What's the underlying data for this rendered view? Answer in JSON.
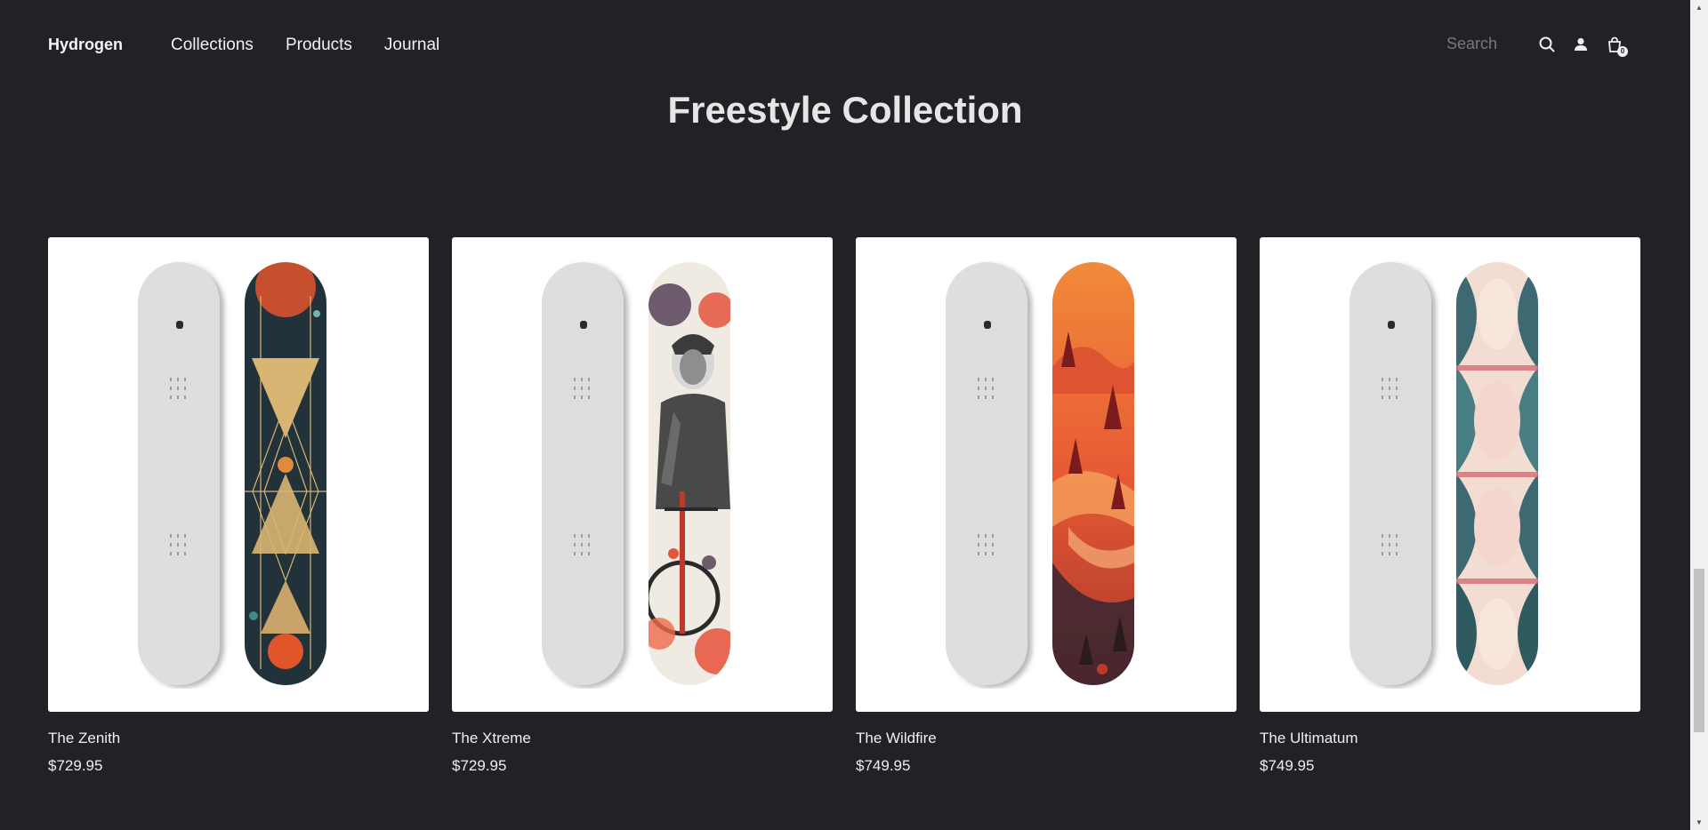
{
  "header": {
    "brand": "Hydrogen",
    "nav": [
      "Collections",
      "Products",
      "Journal"
    ],
    "search_placeholder": "Search",
    "cart_count": "0",
    "icons": [
      "search-icon",
      "account-icon",
      "bag-icon"
    ]
  },
  "collection": {
    "title": "Freestyle Collection"
  },
  "products": [
    {
      "title": "The Zenith",
      "price": "$729.95",
      "design": "geometric"
    },
    {
      "title": "The Xtreme",
      "price": "$729.95",
      "design": "cyclist"
    },
    {
      "title": "The Wildfire",
      "price": "$749.95",
      "design": "wildfire"
    },
    {
      "title": "The Ultimatum",
      "price": "$749.95",
      "design": "ultimatum"
    }
  ],
  "colors": {
    "background": "#212226",
    "text": "#efeff0",
    "card": "#ffffff"
  }
}
